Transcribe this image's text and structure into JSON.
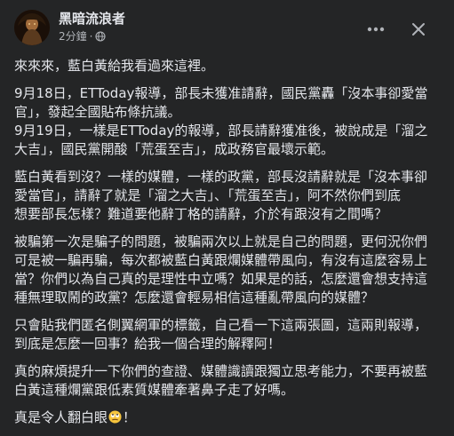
{
  "post": {
    "author": "黑暗流浪者",
    "time": "2分鐘",
    "separator": "·",
    "icons": {
      "privacy": "globe-icon",
      "more": "more-horizontal-icon",
      "close": "close-icon"
    },
    "paragraphs": [
      "來來來，藍白黃給我看過來這裡。",
      "9月18日，ETToday報導，部長未獲准請辭，國民黨轟「沒本事卻愛當\n官」，發起全國貼布條抗議。",
      "9月19日，一樣是ETToday的報導，部長請辭獲准後，被說成是「溜之\n大吉」，國民黨開酸「荒蛋至吉」，成政務官最壞示範。",
      "藍白黃看到沒？一樣的媒體，一樣的政黨，部長沒請辭就是「沒本事卻\n愛當官」，請辭了就是「溜之大吉」、「荒蛋至吉」，阿不然你們到底\n想要部長怎樣？難道要他辭丁格的請辭，介於有跟沒有之間嗎？",
      "被騙第一次是騙子的問題，被騙兩次以上就是自己的問題，更何況你們\n可是被一騙再騙，每次都被藍白黃跟爛媒體帶風向，有沒有這麼容易上\n當？你們以為自己真的是理性中立嗎？如果是的話，怎麼還會想支持這\n種無理取鬧的政黨？怎麼還會輕易相信這種亂帶風向的媒體？",
      "只會貼我們匿名側翼網軍的標籤，自己看一下這兩張圖，這兩則報導，\n到底是怎麼一回事？給我一個合理的解釋阿！",
      "真的麻煩提升一下你們的查證、媒體識讀跟獨立思考能力，不要再被藍\n白黃這種爛黨跟低素質媒體牽著鼻子走了好嗎。"
    ],
    "closing_before": "真是令人翻白眼",
    "closing_emoji": "eye-roll-emoji",
    "closing_after": "！"
  }
}
